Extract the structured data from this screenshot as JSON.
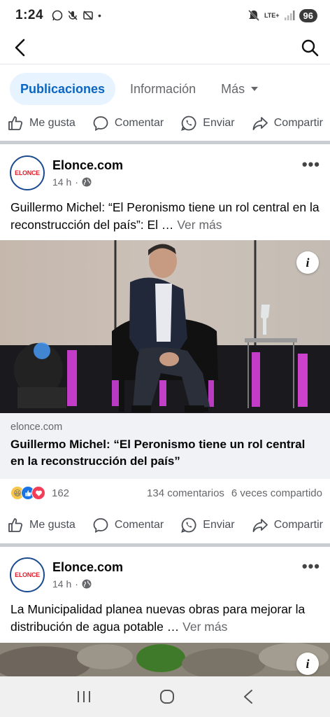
{
  "status": {
    "time": "1:24",
    "network": "LTE+",
    "battery": "96"
  },
  "tabs": [
    {
      "label": "Publicaciones"
    },
    {
      "label": "Información"
    },
    {
      "label": "Más"
    }
  ],
  "actions": {
    "like": "Me gusta",
    "comment": "Comentar",
    "send": "Enviar",
    "share": "Compartir"
  },
  "posts": [
    {
      "avatar_text": "ELONCE",
      "page_name": "Elonce.com",
      "time": "14 h",
      "text": "Guillermo Michel: “El Peronismo tiene un rol central en la reconstrucción del país”: El …",
      "see_more": "Ver más",
      "link_domain": "elonce.com",
      "link_title": "Guillermo Michel: “El Peronismo tiene un rol central en la reconstrucción del país”",
      "reaction_count": "162",
      "comments": "134 comentarios",
      "shares": "6 veces compartido",
      "info_badge": "i"
    },
    {
      "avatar_text": "ELONCE",
      "page_name": "Elonce.com",
      "time": "14 h",
      "text": "La Municipalidad planea nuevas obras para mejorar la distribución de agua potable …",
      "see_more": "Ver más",
      "info_badge": "i"
    }
  ],
  "colors": {
    "accent": "#0a66c2",
    "tab_bg": "#e7f3ff",
    "separator": "#c9ccd1",
    "link_bg": "#f0f2f5"
  }
}
